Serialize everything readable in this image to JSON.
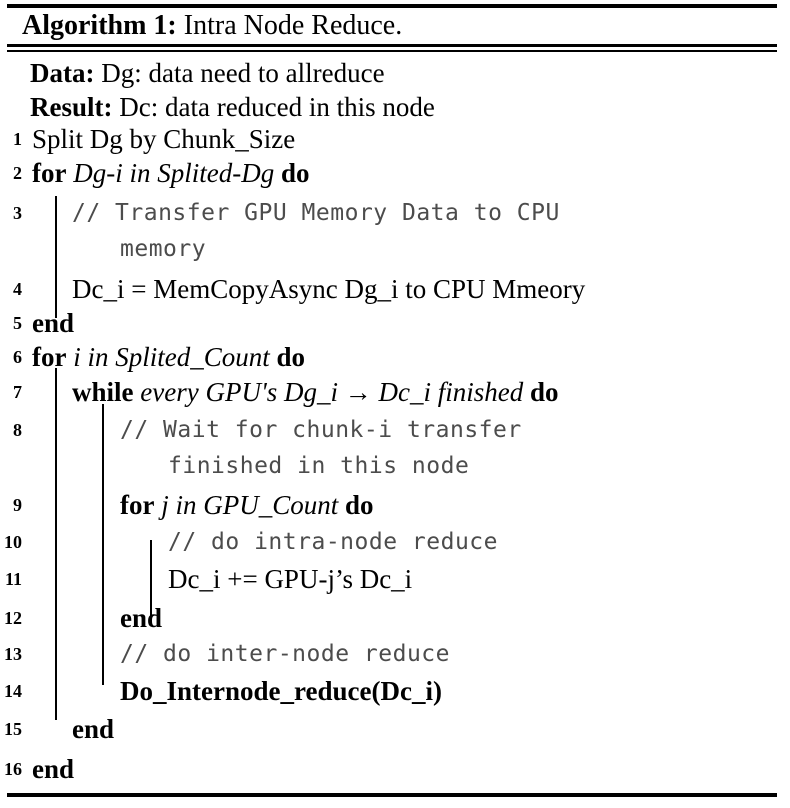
{
  "title": {
    "keyword": "Algorithm 1:",
    "name": "Intra Node Reduce."
  },
  "io": {
    "data_label": "Data:",
    "data_value": "Dg: data need to allreduce",
    "result_label": "Result:",
    "result_value": "Dc: data reduced in this node"
  },
  "lines": [
    {
      "no": "1",
      "text": "Split Dg by Chunk_Size"
    },
    {
      "no": "2",
      "kw1": "for",
      "var": "Dg-i in Splited-Dg",
      "kw2": "do"
    },
    {
      "no": "3",
      "comment": "// Transfer GPU Memory Data to CPU",
      "comment_cont": "memory"
    },
    {
      "no": "4",
      "text": "Dc_i = MemCopyAsync Dg_i to CPU Mmeory"
    },
    {
      "no": "5",
      "kw1": "end"
    },
    {
      "no": "6",
      "kw1": "for",
      "var": "i in Splited_Count",
      "kw2": "do"
    },
    {
      "no": "7",
      "kw1": "while",
      "var": "every GPU's Dg_i → Dc_i finished",
      "kw2": "do"
    },
    {
      "no": "8",
      "comment": "// Wait for chunk-i transfer",
      "comment_cont": "finished in this node"
    },
    {
      "no": "9",
      "kw1": "for",
      "var": "j in GPU_Count",
      "kw2": "do"
    },
    {
      "no": "10",
      "comment": "// do intra-node reduce"
    },
    {
      "no": "11",
      "text": "Dc_i += GPU-j’s Dc_i"
    },
    {
      "no": "12",
      "kw1": "end"
    },
    {
      "no": "13",
      "comment": "// do inter-node reduce"
    },
    {
      "no": "14",
      "bold_text": "Do_Internode_reduce(Dc_i)"
    },
    {
      "no": "15",
      "kw1": "end"
    },
    {
      "no": "16",
      "kw1": "end"
    }
  ],
  "colors": {
    "rule": "#000000",
    "text": "#000000",
    "comment": "#4c4c4c"
  }
}
